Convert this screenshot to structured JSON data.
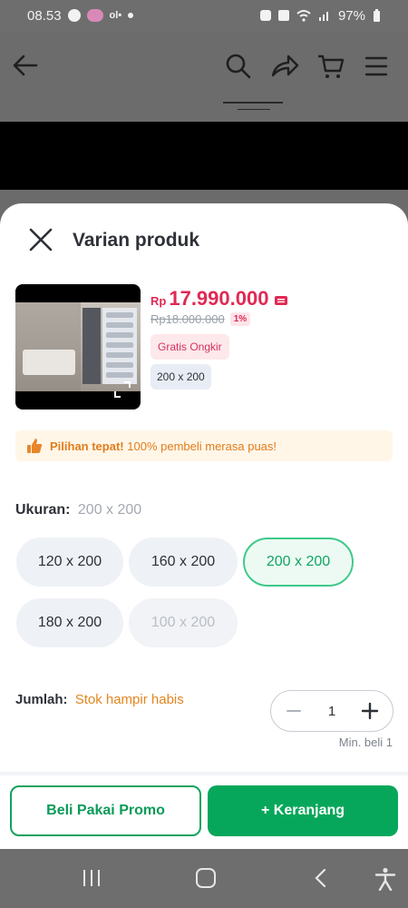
{
  "status_bar": {
    "time": "08.53",
    "small_label": "ol•",
    "battery": "97%"
  },
  "sheet": {
    "title": "Varian produk",
    "product": {
      "currency": "Rp",
      "price": "17.990.000",
      "original_price": "Rp18.000.000",
      "discount": "1%",
      "free_shipping": "Gratis Ongkir",
      "selected_variant": "200 x 200"
    },
    "promo_banner": {
      "bold": "Pilihan tepat!",
      "text": "100% pembeli merasa puas!"
    },
    "size": {
      "label": "Ukuran:",
      "selected": "200 x 200",
      "options": [
        "120 x 200",
        "160 x 200",
        "200 x 200",
        "180 x 200",
        "100 x 200"
      ]
    },
    "quantity": {
      "label": "Jumlah:",
      "stock_note": "Stok hampir habis",
      "value": "1",
      "min_note": "Min. beli 1"
    },
    "buttons": {
      "promo": "Beli Pakai Promo",
      "cart": "+ Keranjang"
    }
  },
  "colors": {
    "primary_green": "#07a75b",
    "price_red": "#e02954",
    "warning_orange": "#e2861f"
  },
  "icons": [
    "back-icon",
    "search-icon",
    "share-icon",
    "cart-icon",
    "menu-icon",
    "close-icon",
    "expand-icon",
    "thumbs-up-icon",
    "minus-icon",
    "plus-icon",
    "recent-apps-icon",
    "home-icon",
    "back-nav-icon",
    "accessibility-icon"
  ]
}
